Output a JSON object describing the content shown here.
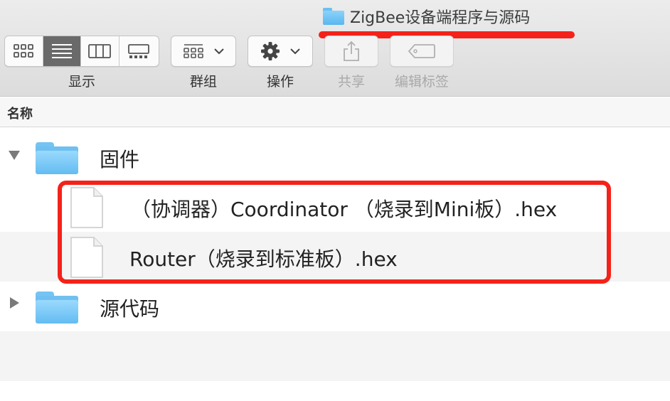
{
  "window": {
    "title": "ZigBee设备端程序与源码"
  },
  "toolbar": {
    "view_label": "显示",
    "group_label": "群组",
    "action_label": "操作",
    "share_label": "共享",
    "tags_label": "编辑标签",
    "active_view": "list-view"
  },
  "columns": {
    "name": "名称"
  },
  "rows": [
    {
      "kind": "folder",
      "label": "固件",
      "expanded": true
    },
    {
      "kind": "file",
      "label": "（协调器）Coordinator （烧录到Mini板）.hex"
    },
    {
      "kind": "file",
      "label": "Router（烧录到标准板）.hex"
    },
    {
      "kind": "folder",
      "label": "源代码",
      "expanded": false
    }
  ],
  "colors": {
    "annotation_red": "#f4221a",
    "folder_blue": "#63bcf2",
    "selected_segment": "#6a6a6a"
  }
}
